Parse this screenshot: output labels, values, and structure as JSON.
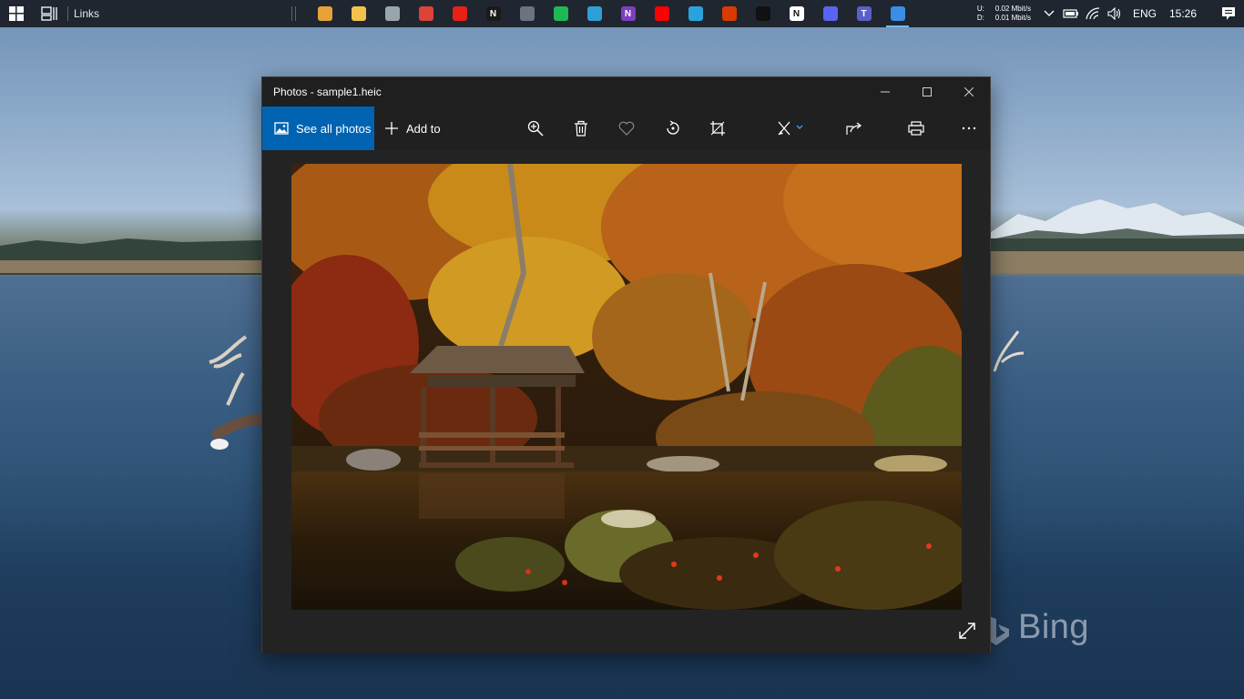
{
  "taskbar": {
    "links_label": "Links",
    "pinned_apps": [
      {
        "name": "microsoft-store-icon",
        "letter": "",
        "color": "#e8a23a"
      },
      {
        "name": "file-explorer-icon",
        "letter": "",
        "color": "#f2c14e"
      },
      {
        "name": "app-icon-grey",
        "letter": "",
        "color": "#9aa4ad"
      },
      {
        "name": "chrome-icon",
        "letter": "",
        "color": "#db4437"
      },
      {
        "name": "youtube-music-icon",
        "letter": "",
        "color": "#e62117"
      },
      {
        "name": "netflix-icon",
        "letter": "N",
        "color": "#1a1a1a"
      },
      {
        "name": "app-icon-lines",
        "letter": "",
        "color": "#6b7480"
      },
      {
        "name": "spotify-icon",
        "letter": "",
        "color": "#1db954"
      },
      {
        "name": "edge-icon",
        "letter": "",
        "color": "#2e9fd8"
      },
      {
        "name": "onenote-icon",
        "letter": "N",
        "color": "#7d3fbf"
      },
      {
        "name": "youtube-icon",
        "letter": "",
        "color": "#ff0000"
      },
      {
        "name": "telegram-icon",
        "letter": "",
        "color": "#2aa3dc"
      },
      {
        "name": "office-icon",
        "letter": "",
        "color": "#d83b01"
      },
      {
        "name": "dolby-icon",
        "letter": "",
        "color": "#111111"
      },
      {
        "name": "notion-icon",
        "letter": "N",
        "color": "#ffffff"
      },
      {
        "name": "discord-icon",
        "letter": "",
        "color": "#5865f2"
      },
      {
        "name": "teams-icon",
        "letter": "T",
        "color": "#5b5fc7"
      },
      {
        "name": "photos-icon",
        "letter": "",
        "color": "#3a8ee6"
      }
    ],
    "net_up_label": "U:",
    "net_down_label": "D:",
    "net_up": "0.02 Mbit/s",
    "net_down": "0.01 Mbit/s",
    "language": "ENG",
    "time": "15:26"
  },
  "window": {
    "title": "Photos - sample1.heic",
    "see_all_photos": "See all photos",
    "add_to": "Add to",
    "accent_color": "#0063b1"
  },
  "wallpaper": {
    "watermark": "Bing"
  }
}
